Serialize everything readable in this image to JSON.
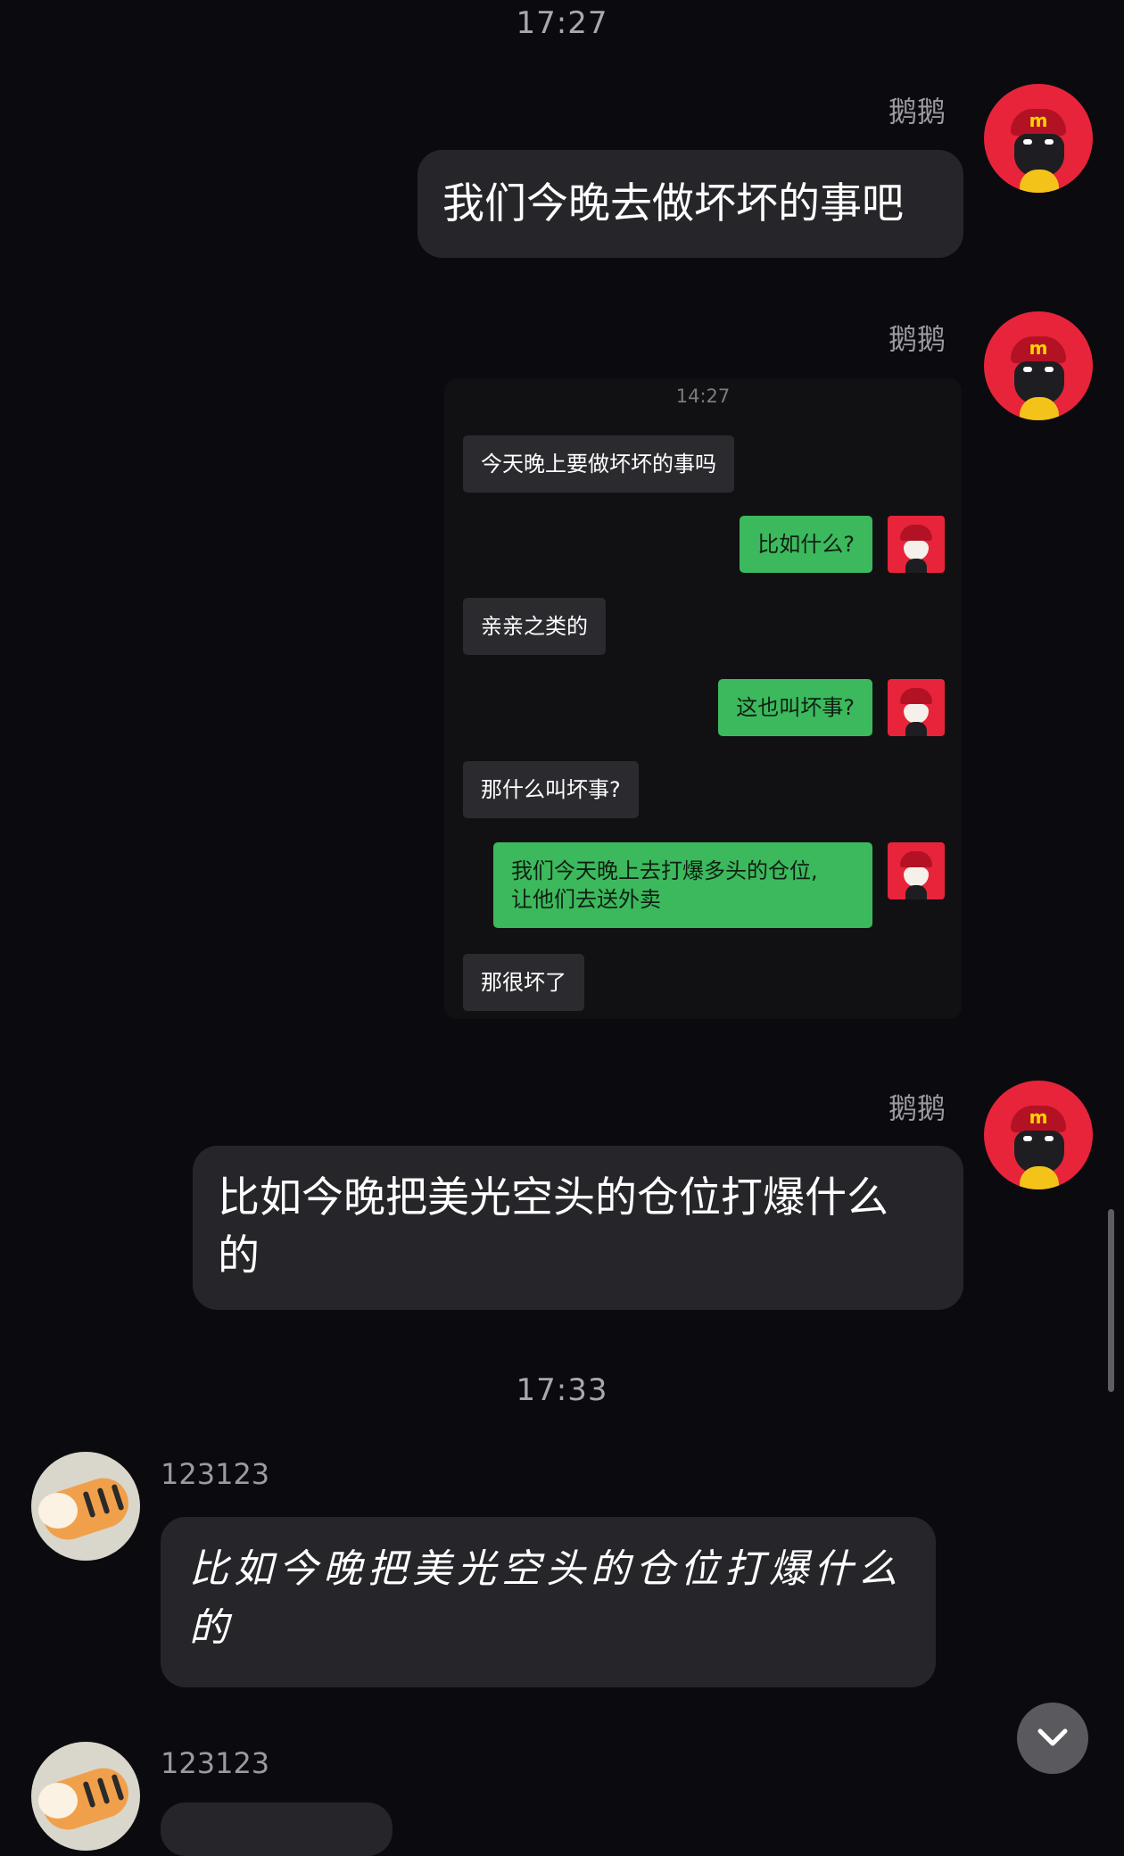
{
  "chat": {
    "time_1": "17:27",
    "time_2": "17:33",
    "self_name": "鹅鹅",
    "other_name": "123123",
    "messages": {
      "m1": "我们今晚去做坏坏的事吧",
      "m3_line1": "比如今晚把美光空头的仓位打爆什么",
      "m3_line2": "的",
      "m4_line1": "比如今晚把美光空头的仓位打爆什么",
      "m4_line2": "的"
    }
  },
  "embedded_screenshot": {
    "time": "14:27",
    "messages": [
      {
        "side": "left",
        "text": "今天晚上要做坏坏的事吗"
      },
      {
        "side": "right",
        "text": "比如什么?"
      },
      {
        "side": "left",
        "text": "亲亲之类的"
      },
      {
        "side": "right",
        "text": "这也叫坏事?"
      },
      {
        "side": "left",
        "text": "那什么叫坏事?"
      },
      {
        "side": "right",
        "text_line1": "我们今天晚上去打爆多头的仓位,",
        "text_line2": "让他们去送外卖"
      },
      {
        "side": "left",
        "text": "那很坏了"
      }
    ]
  },
  "icons": {
    "scroll_down": "chevron-down-icon"
  },
  "colors": {
    "background": "#0b0b0f",
    "bubble": "#26262a",
    "embed_green": "#3cb95d",
    "avatar_red": "#e8243a"
  }
}
